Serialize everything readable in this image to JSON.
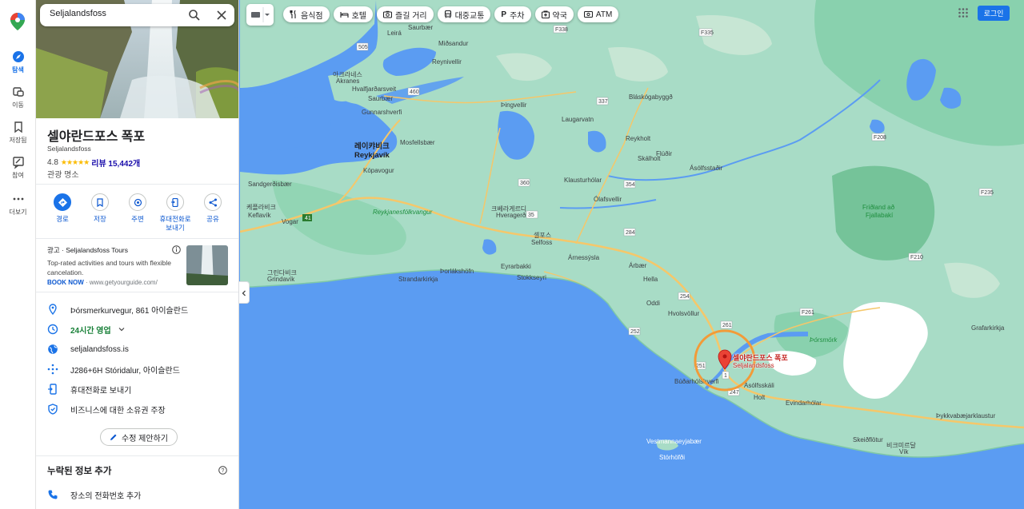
{
  "search": {
    "value": "Seljalandsfoss"
  },
  "rail": {
    "items": [
      {
        "label": "탐색",
        "active": true
      },
      {
        "label": "이동"
      },
      {
        "label": "저장됨"
      },
      {
        "label": "참여"
      },
      {
        "label": "더보기"
      }
    ]
  },
  "place": {
    "title": "셀야란드포스 폭포",
    "subtitle": "Seljalandsfoss",
    "rating": "4.8",
    "stars": "★★★★★",
    "reviews": "리뷰 15,442개",
    "category": "관광 명소"
  },
  "actions": [
    {
      "label": "경로",
      "icon": "directions-icon"
    },
    {
      "label": "저장",
      "icon": "bookmark-icon"
    },
    {
      "label": "주변",
      "icon": "nearby-icon"
    },
    {
      "label": "휴대전화로 보내기",
      "icon": "send-to-phone-icon"
    },
    {
      "label": "공유",
      "icon": "share-icon"
    }
  ],
  "ad": {
    "title": "광고 · Seljalandsfoss Tours",
    "desc": "Top-rated activities and tours with flexible cancelation.",
    "cta": "BOOK NOW",
    "url": " · www.getyourguide.com/"
  },
  "info": {
    "address": "Þórsmerkurvegur, 861 아이슬란드",
    "hours": "24시간 영업",
    "website": "seljalandsfoss.is",
    "pluscode": "J286+6H Stóridalur, 아이슬란드",
    "send_phone": "휴대전화로 보내기",
    "claim": "비즈니스에 대한 소유권 주장"
  },
  "suggest_edit": "수정 제안하기",
  "missing": {
    "title": "누락된 정보 추가",
    "phone": "장소의 전화번호 추가"
  },
  "chips": [
    {
      "label": "음식점",
      "icon": "restaurant-icon"
    },
    {
      "label": "호텔",
      "icon": "hotel-icon"
    },
    {
      "label": "즐길 거리",
      "icon": "camera-icon"
    },
    {
      "label": "대중교통",
      "icon": "transit-icon"
    },
    {
      "label": "주차",
      "icon": "parking-icon"
    },
    {
      "label": "약국",
      "icon": "pharmacy-icon"
    },
    {
      "label": "ATM",
      "icon": "atm-icon"
    }
  ],
  "login": "로그인",
  "map": {
    "marker_label_ko": "셀야란드포스 폭포",
    "marker_label_en": "Seljalandsfoss",
    "places": [
      "Saurbær",
      "Mið­sandur",
      "Reynivellir",
      "Leirá",
      "Akranes",
      "아크라네스",
      "Hvalfjarðarsveit",
      "Saurbær",
      "Gunnarshverfi",
      "Þingvellir",
      "Laugarvatn",
      "Bláskógabyggð",
      "Reykholt",
      "Skálholt",
      "Flúðir",
      "Klausturhólar",
      "Ásólfsstaðir",
      "레이캬비크",
      "Reykjavík",
      "Kópavogur",
      "Mosfellsbær",
      "Reykjanesfólkvangur",
      "크베라게르디",
      "Hveragerði",
      "셀포스",
      "Selfoss",
      "Flúðir",
      "Árnessýsla",
      "Árbær",
      "Hella",
      "Oddi",
      "Hvolsvöllur",
      "Þórsmörk",
      "Fljótshlíð",
      "Búðarhólshverfi",
      "Holt",
      "Ásólfsskáli",
      "Evindarhólar",
      "Skógafoss",
      "Þykkvabæjarklaustur",
      "케플라비크",
      "Keflavík",
      "그린다비크",
      "Grindavík",
      "Vogar",
      "Þorlákshöfn",
      "Eyrarbakki",
      "Stokkseyri",
      "Strandarkirkja",
      "Vestmannaeyjabær",
      "Stórhöfði",
      "비크미르달",
      "Vík",
      "Friðland að Fjallabaki",
      "Ólafsvellir",
      "Grafarkirkja",
      "Skeiðflötur"
    ]
  }
}
